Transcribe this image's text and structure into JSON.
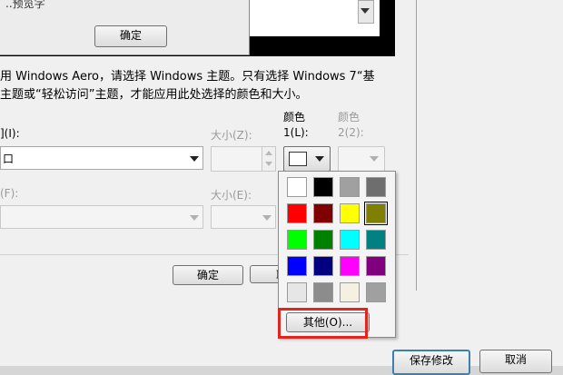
{
  "inner_dialog": {
    "title_fragment": "..预览字",
    "confirm_label": "确定"
  },
  "info_text": {
    "line1": "用 Windows Aero，请选择 Windows 主题。只有选择 Windows 7“基",
    "line2": "主题或“轻松访问”主题，才能应用此处选择的颜色和大小。"
  },
  "item": {
    "label": "](I):",
    "value": "口"
  },
  "size1": {
    "label": "大小(Z):"
  },
  "color1": {
    "label_top": "颜色",
    "label_bottom": "1(L):"
  },
  "color2": {
    "label_top": "颜色",
    "label_bottom": "2(2):"
  },
  "font": {
    "label": "(F):"
  },
  "size2": {
    "label": "大小(E):"
  },
  "dialog_buttons": {
    "ok_label": "确定",
    "cancel_fragment": "耶"
  },
  "palette": {
    "colors": [
      "#ffffff",
      "#000000",
      "#a0a0a0",
      "#6e6e6e",
      "#ff0000",
      "#800000",
      "#ffff00",
      "#808000",
      "#00ff00",
      "#008000",
      "#00ffff",
      "#008080",
      "#0000ff",
      "#000080",
      "#ff00ff",
      "#800080",
      "#e6e6e6",
      "#8c8c8c",
      "#f4f0e2",
      "#a0a0a0"
    ],
    "selected_index": 7,
    "other_label": "其他(O)..."
  },
  "footer": {
    "save_label": "保存修改",
    "cancel_label": "取消"
  },
  "colors": {
    "highlight": "#e0261f",
    "focus_border": "#3c7fb1"
  }
}
